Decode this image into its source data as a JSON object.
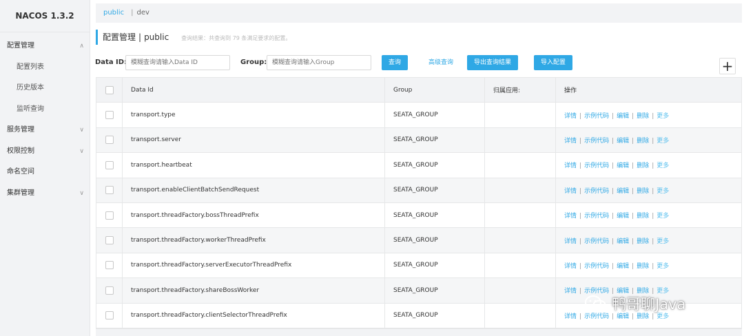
{
  "app": {
    "title": "NACOS 1.3.2"
  },
  "sidebar": {
    "items": [
      {
        "label": "配置管理",
        "chev": "∧",
        "level": 1
      },
      {
        "label": "配置列表",
        "level": 2
      },
      {
        "label": "历史版本",
        "level": 2
      },
      {
        "label": "监听查询",
        "level": 2
      },
      {
        "label": "服务管理",
        "chev": "∨",
        "level": 1
      },
      {
        "label": "权限控制",
        "chev": "∨",
        "level": 1
      },
      {
        "label": "命名空间",
        "level": 1
      },
      {
        "label": "集群管理",
        "chev": "∨",
        "level": 1
      }
    ]
  },
  "namespace_bar": {
    "public": "public",
    "sep": "|",
    "dev": "dev"
  },
  "page_header": {
    "title": "配置管理",
    "separator": "|",
    "namespace": "public",
    "summary": "查询结果：共查询到 79 条满足要求的配置。"
  },
  "filters": {
    "data_id_label": "Data ID:",
    "data_id_placeholder": "模糊查询请输入Data ID",
    "group_label": "Group:",
    "group_placeholder": "模糊查询请输入Group",
    "query_button": "查询",
    "advanced_query": "高级查询",
    "export_button": "导出查询结果",
    "import_button": "导入配置"
  },
  "add_icon": "+",
  "table": {
    "headers": {
      "data_id": "Data Id",
      "group": "Group",
      "app": "归属应用:",
      "ops": "操作"
    },
    "ops": {
      "detail": "详情",
      "sample": "示例代码",
      "edit": "编辑",
      "delete": "删除",
      "more": "更多",
      "sep": "|"
    },
    "rows": [
      {
        "data_id": "transport.type",
        "group": "SEATA_GROUP",
        "app": ""
      },
      {
        "data_id": "transport.server",
        "group": "SEATA_GROUP",
        "app": ""
      },
      {
        "data_id": "transport.heartbeat",
        "group": "SEATA_GROUP",
        "app": ""
      },
      {
        "data_id": "transport.enableClientBatchSendRequest",
        "group": "SEATA_GROUP",
        "app": ""
      },
      {
        "data_id": "transport.threadFactory.bossThreadPrefix",
        "group": "SEATA_GROUP",
        "app": ""
      },
      {
        "data_id": "transport.threadFactory.workerThreadPrefix",
        "group": "SEATA_GROUP",
        "app": ""
      },
      {
        "data_id": "transport.threadFactory.serverExecutorThreadPrefix",
        "group": "SEATA_GROUP",
        "app": ""
      },
      {
        "data_id": "transport.threadFactory.shareBossWorker",
        "group": "SEATA_GROUP",
        "app": ""
      },
      {
        "data_id": "transport.threadFactory.clientSelectorThreadPrefix",
        "group": "SEATA_GROUP",
        "app": ""
      }
    ]
  },
  "watermark": {
    "text": "鸭哥聊Java"
  }
}
